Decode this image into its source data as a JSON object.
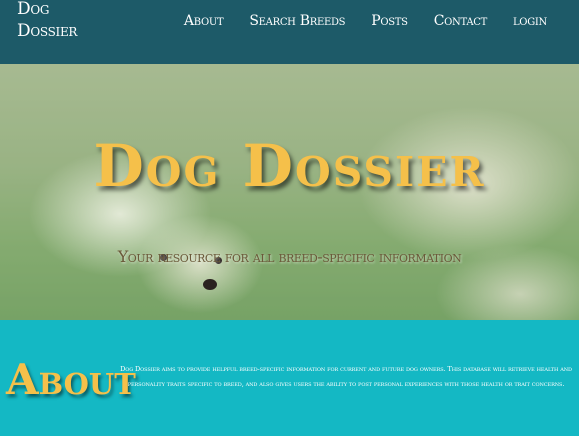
{
  "nav": {
    "brand": "Dog Dossier",
    "links": [
      "About",
      "Search Breeds",
      "Posts",
      "Contact",
      "login"
    ]
  },
  "hero": {
    "title": "Dog Dossier",
    "subtitle": "Your resource for all breed-specific information"
  },
  "about": {
    "heading": "About",
    "text": "Dog Dossier aims to provide helpful breed-specific information for current and future dog owners. This database will retrieve health and personality traits specific to breed, and also gives users the ability to post personal experiences with those health or trait concerns."
  },
  "colors": {
    "navbar": "#1d5a68",
    "accent": "#f5c04a",
    "about_bg": "#14b8c4"
  }
}
